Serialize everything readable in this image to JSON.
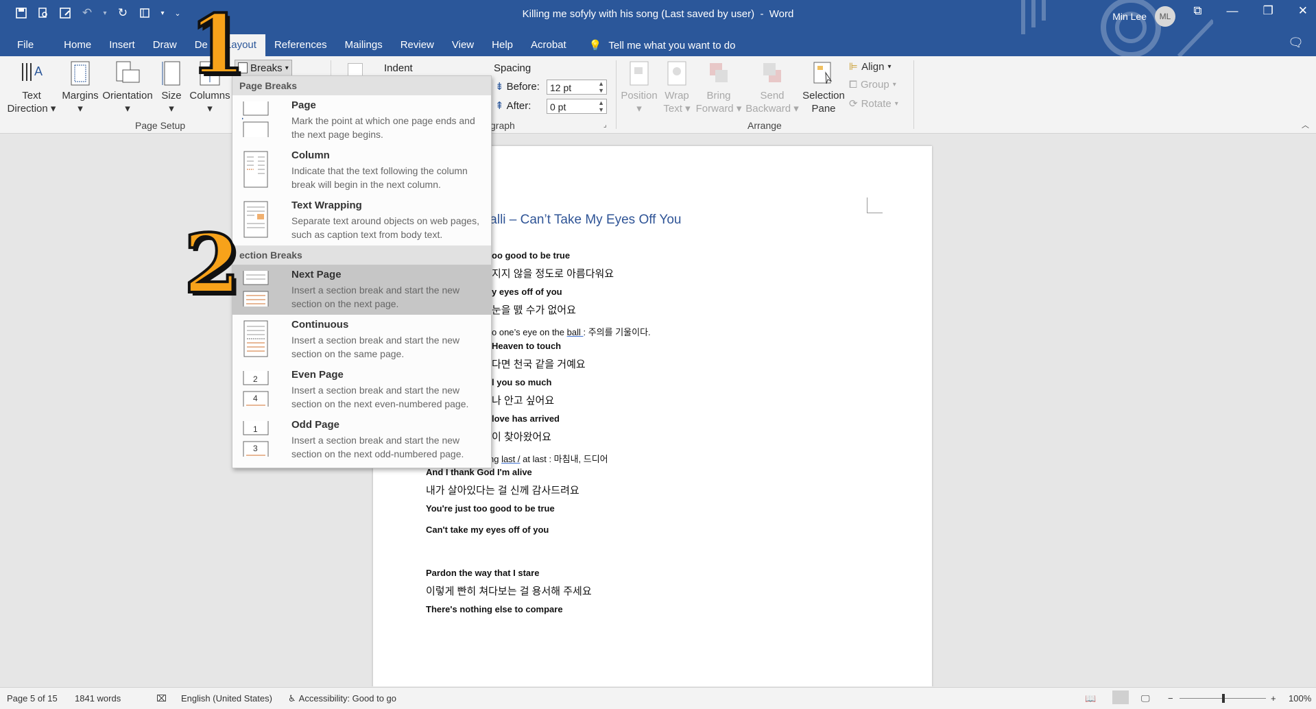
{
  "title_bar": {
    "document_title": "Killing me sofyly with his song (Last saved by user)",
    "separator": "-",
    "app_name": "Word",
    "user_name": "Min Lee",
    "user_initials": "ML"
  },
  "tabs": [
    "File",
    "Home",
    "Insert",
    "Draw",
    "De",
    "Layout",
    "References",
    "Mailings",
    "Review",
    "View",
    "Help",
    "Acrobat"
  ],
  "active_tab": "Layout",
  "tell_me": "Tell me what you want to do",
  "ribbon": {
    "page_setup": {
      "text_direction": [
        "Text",
        "Direction"
      ],
      "margins": "Margins",
      "orientation": "Orientation",
      "size": "Size",
      "columns": "Columns",
      "breaks": "Breaks",
      "group_label": "Page Setup"
    },
    "paragraph": {
      "indent_label": "Indent",
      "spacing_label": "Spacing",
      "before_label": "Before:",
      "before_value": "12 pt",
      "after_label": "After:",
      "after_value": "0 pt",
      "group_label_partial": "graph"
    },
    "arrange": {
      "position": "Position",
      "wrap_text": [
        "Wrap",
        "Text"
      ],
      "bring_forward": [
        "Bring",
        "Forward"
      ],
      "send_backward": [
        "Send",
        "Backward"
      ],
      "selection_pane": [
        "Selection",
        "Pane"
      ],
      "align": "Align",
      "group": "Group",
      "rotate": "Rotate",
      "group_label": "Arrange"
    }
  },
  "breaks_menu": {
    "page_breaks_header": "Page Breaks",
    "section_breaks_header": "ection Breaks",
    "page_items": [
      {
        "title": "Page",
        "desc": "Mark the point at which one page ends and the next page begins."
      },
      {
        "title": "Column",
        "desc": "Indicate that the text following the column break will begin in the next column."
      },
      {
        "title": "Text Wrapping",
        "desc": "Separate text around objects on web pages, such as caption text from body text."
      }
    ],
    "section_items": [
      {
        "title": "Next Page",
        "desc": "Insert a section break and start the new section on the next page."
      },
      {
        "title": "Continuous",
        "desc": "Insert a section break and start the new section on the same page."
      },
      {
        "title": "Even Page",
        "desc": "Insert a section break and start the new section on the next even-numbered page."
      },
      {
        "title": "Odd Page",
        "desc": "Insert a section break and start the new section on the next odd-numbered page."
      }
    ],
    "highlighted": "Next Page"
  },
  "annotations": {
    "step1": "1",
    "step2": "2"
  },
  "document": {
    "heading": "/alli – Can’t Take My Eyes Off You",
    "lines": [
      {
        "cls": "en",
        "text": "oo good to be true"
      },
      {
        "cls": "ko",
        "text": "지지 않을 정도로 아름다워요"
      },
      {
        "cls": "en",
        "text": "y eyes off of you"
      },
      {
        "cls": "ko",
        "text": "눈을 뗈 수가 없어요"
      },
      {
        "cls": "en",
        "text": "Heaven to touch"
      },
      {
        "cls": "ko",
        "text": "다면 천국 같을 거예요"
      },
      {
        "cls": "en",
        "text": "l you so much"
      },
      {
        "cls": "ko",
        "text": "나 안고 싶어요"
      },
      {
        "cls": "en",
        "text": "love has arrived"
      },
      {
        "cls": "ko",
        "text": "이 찾아왔어요"
      },
      {
        "cls": "en",
        "text": "And I thank God I'm alive"
      },
      {
        "cls": "ko",
        "text": "내가 살아있다는 걸 신께 감사드려요"
      },
      {
        "cls": "en",
        "text": "You're just too good to be true"
      },
      {
        "cls": "en",
        "text": "Can't take my eyes off of you"
      },
      {
        "cls": "en",
        "text": "Pardon the way that I stare"
      },
      {
        "cls": "ko",
        "text": "이렇게 빤히 쳐다보는 걸 용서해 주세요"
      },
      {
        "cls": "en",
        "text": "There's nothing else to compare"
      }
    ],
    "note1": {
      "pre": "o one’s eye on the ",
      "ul": "ball ",
      "post": ": 주의를 기울이다."
    },
    "note2": {
      "bullet": "-",
      "pre": "At long ",
      "ul": "last /",
      "post": " at last : 마침내, 드디어"
    }
  },
  "status_bar": {
    "page": "Page 5 of 15",
    "words": "1841 words",
    "language": "English (United States)",
    "accessibility": "Accessibility: Good to go",
    "zoom": "100%",
    "zoom_minus": "−",
    "zoom_plus": "+"
  },
  "colors": {
    "word_blue": "#2b579a",
    "ribbon_bg": "#f3f3f3",
    "menu_highlight": "#c6c6c6",
    "heading_blue": "#2f5496",
    "number_orange": "#f7a21a"
  }
}
